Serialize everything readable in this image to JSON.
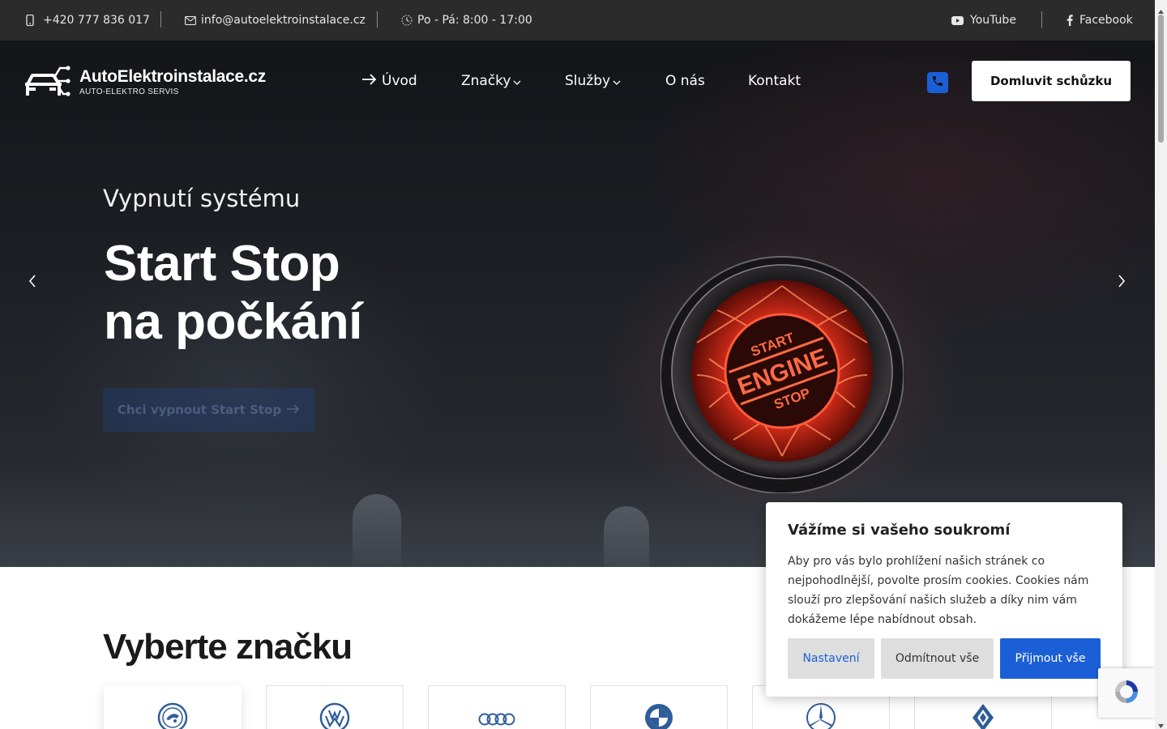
{
  "topbar": {
    "phone": "+420 777 836 017",
    "email": "info@autoelektroinstalace.cz",
    "hours": "Po - Pá: 8:00 - 17:00",
    "youtube": "YouTube",
    "facebook": "Facebook"
  },
  "logo": {
    "name": "AutoElektroinstalace.cz",
    "tagline": "AUTO-ELEKTRO SERVIS"
  },
  "nav": {
    "items": [
      {
        "label": "Úvod"
      },
      {
        "label": "Značky"
      },
      {
        "label": "Služby"
      },
      {
        "label": "O nás"
      },
      {
        "label": "Kontakt"
      }
    ],
    "cta": "Domluvit schůzku"
  },
  "hero": {
    "subtitle": "Vypnutí systému",
    "title_line1": "Start Stop",
    "title_line2": "na počkání",
    "cta": "Chci vypnout Start Stop",
    "engine_text": {
      "top": "START",
      "middle": "ENGINE",
      "bottom": "STOP"
    }
  },
  "brands": {
    "title": "Vyberte značku",
    "items": [
      {
        "name": "Škoda",
        "icon": "skoda-logo-icon"
      },
      {
        "name": "Volkswagen",
        "icon": "vw-logo-icon"
      },
      {
        "name": "Audi",
        "icon": "audi-logo-icon"
      },
      {
        "name": "BMW",
        "icon": "bmw-logo-icon"
      },
      {
        "name": "Mercedes-Benz",
        "icon": "mercedes-logo-icon"
      },
      {
        "name": "Renault",
        "icon": "renault-logo-icon"
      }
    ]
  },
  "cookie": {
    "title": "Vážíme si vašeho soukromí",
    "text": "Aby pro vás bylo prohlížení našich stránek co nejpohodlnější, povolte prosím cookies. Cookies nám slouží pro zlepšování našich služeb a díky nim vám dokážeme lépe nabídnout obsah.",
    "settings": "Nastavení",
    "reject": "Odmítnout vše",
    "accept": "Přijmout vše"
  },
  "colors": {
    "accent": "#1b5fd6",
    "topbar_bg": "#2b2b2b",
    "engine_red": "#ff3b25"
  }
}
